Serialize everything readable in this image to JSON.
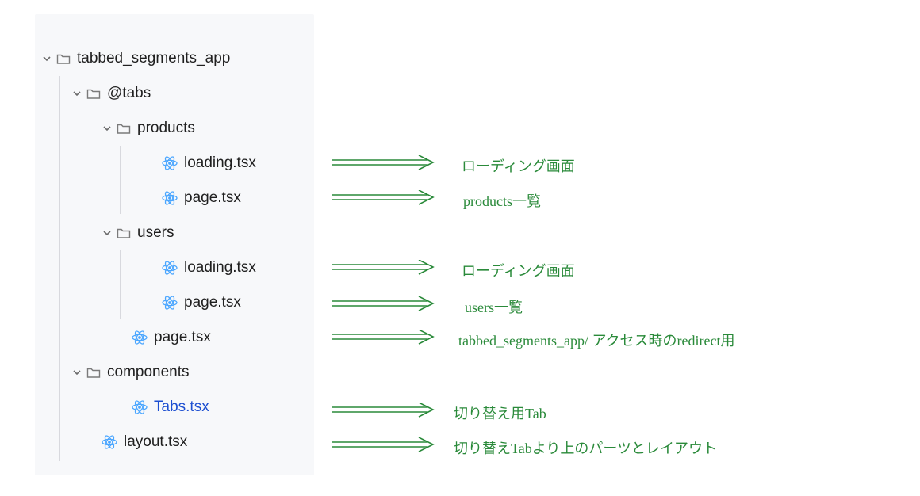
{
  "tree": {
    "root": {
      "name": "tabbed_segments_app",
      "type": "folder"
    },
    "tabs": {
      "name": "@tabs",
      "type": "folder"
    },
    "products": {
      "name": "products",
      "type": "folder"
    },
    "products_loading": {
      "name": "loading.tsx",
      "type": "tsx"
    },
    "products_page": {
      "name": "page.tsx",
      "type": "tsx"
    },
    "users": {
      "name": "users",
      "type": "folder"
    },
    "users_loading": {
      "name": "loading.tsx",
      "type": "tsx"
    },
    "users_page": {
      "name": "page.tsx",
      "type": "tsx"
    },
    "tabs_page": {
      "name": "page.tsx",
      "type": "tsx"
    },
    "components": {
      "name": "components",
      "type": "folder"
    },
    "tabs_tsx": {
      "name": "Tabs.tsx",
      "type": "tsx",
      "highlighted": true
    },
    "layout": {
      "name": "layout.tsx",
      "type": "tsx"
    }
  },
  "annotations": {
    "a1": "ローディング画面",
    "a2": "products一覧",
    "a3": "ローディング画面",
    "a4": "users一覧",
    "a5": "tabbed_segments_app/ アクセス時のredirect用",
    "a6": "切り替え用Tab",
    "a7": "切り替えTabより上のパーツとレイアウト"
  },
  "colors": {
    "annotation": "#2a8a3a",
    "panel": "#f7f8fa",
    "highlight": "#1d4fd1",
    "react_icon": "#4aa6ff"
  }
}
